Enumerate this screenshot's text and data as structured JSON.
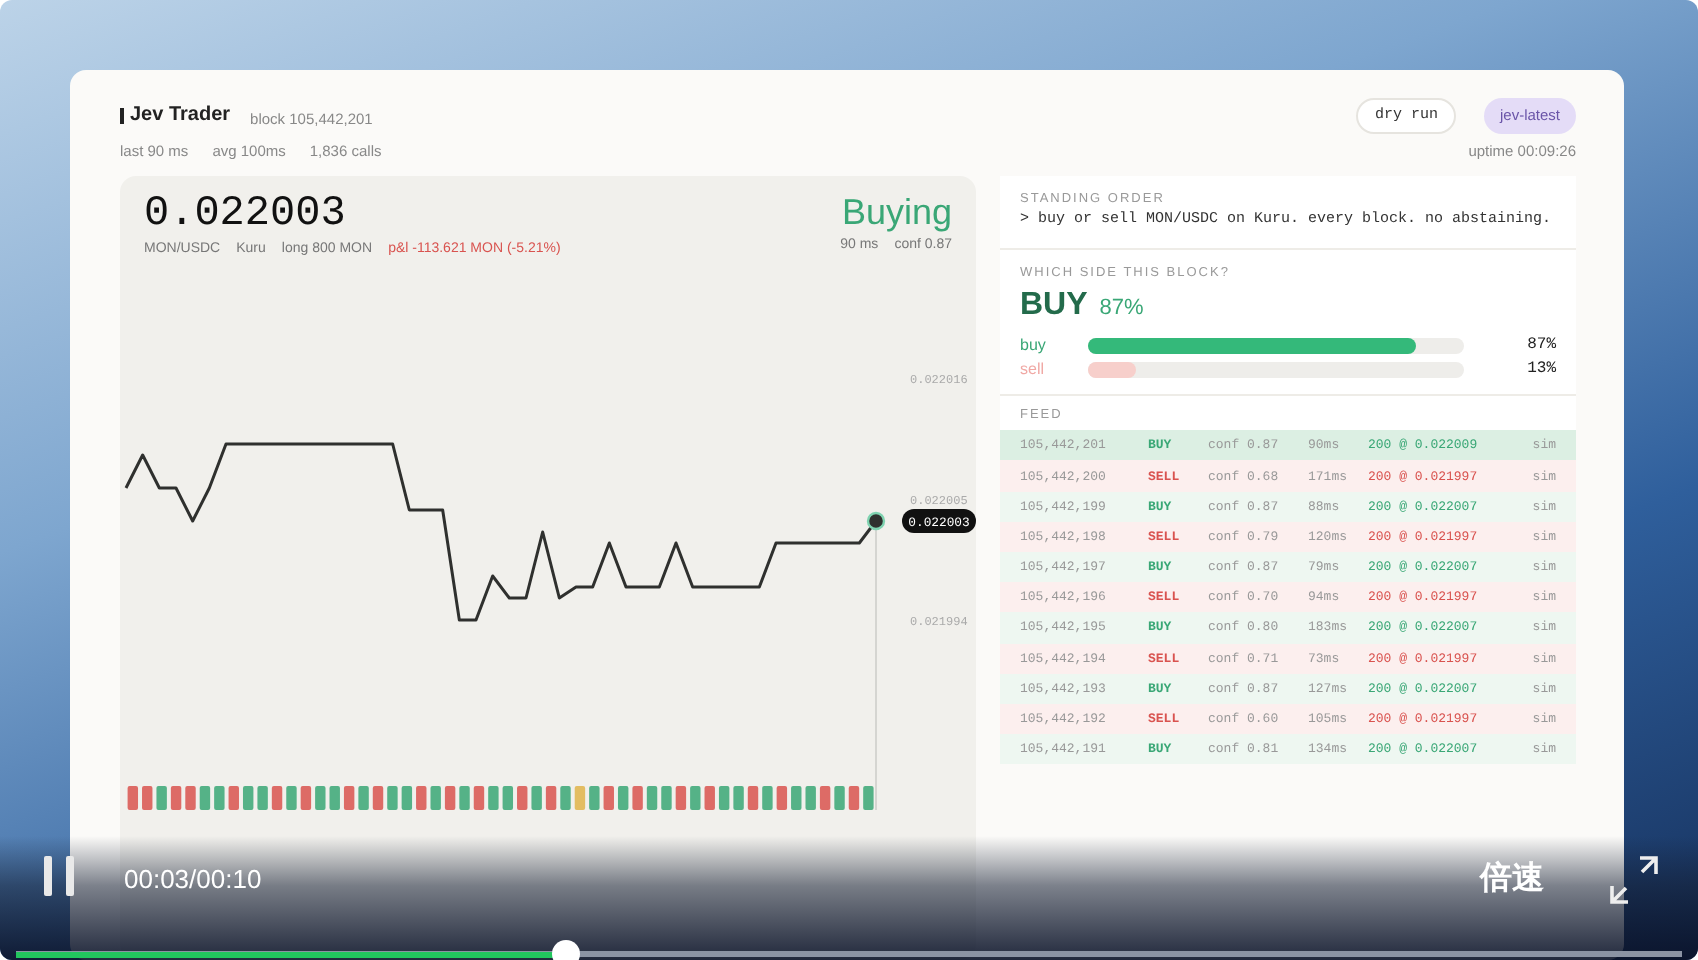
{
  "header": {
    "title": "Jev Trader",
    "block": "block 105,442,201",
    "stats": [
      "last 90 ms",
      "avg 100ms",
      "1,836 calls"
    ],
    "badges": [
      {
        "label": "dry run",
        "kind": "outline"
      },
      {
        "label": "jev-latest",
        "kind": "tag"
      }
    ],
    "uptime": "uptime 00:09:26"
  },
  "price_panel": {
    "price": "0.022003",
    "pair": "MON/USDC",
    "venue": "Kuru",
    "position": "long 800 MON",
    "pnl": "p&l -113.621 MON (-5.21%)",
    "action": "Buying",
    "latency": "90 ms",
    "confidence": "conf 0.87",
    "last_price_tag": "0.022003",
    "chart_data": {
      "type": "line",
      "ylim": [
        0.021994,
        0.022016
      ],
      "series": [
        {
          "color": "#2f302e",
          "values": [
            0.022006,
            0.022009,
            0.022006,
            0.022006,
            0.022003,
            0.022006,
            0.02201,
            0.02201,
            0.02201,
            0.02201,
            0.02201,
            0.02201,
            0.02201,
            0.02201,
            0.02201,
            0.02201,
            0.02201,
            0.022004,
            0.022004,
            0.022004,
            0.021994,
            0.021994,
            0.021998,
            0.021996,
            0.021996,
            0.022002,
            0.021996,
            0.021997,
            0.021997,
            0.022001,
            0.021997,
            0.021997,
            0.021997,
            0.022001,
            0.021997,
            0.021997,
            0.021997,
            0.021997,
            0.021997,
            0.022001,
            0.022001,
            0.022001,
            0.022001,
            0.022001,
            0.022001,
            0.022003
          ]
        }
      ],
      "yticks": [
        0.021994,
        0.022005,
        0.022016
      ]
    },
    "signal_strip": [
      {
        "kind": "sell"
      },
      {
        "kind": "sell"
      },
      {
        "kind": "buy"
      },
      {
        "kind": "sell"
      },
      {
        "kind": "sell"
      },
      {
        "kind": "buy"
      },
      {
        "kind": "buy"
      },
      {
        "kind": "sell"
      },
      {
        "kind": "buy"
      },
      {
        "kind": "buy"
      },
      {
        "kind": "sell"
      },
      {
        "kind": "buy"
      },
      {
        "kind": "sell"
      },
      {
        "kind": "buy"
      },
      {
        "kind": "buy"
      },
      {
        "kind": "sell"
      },
      {
        "kind": "buy"
      },
      {
        "kind": "sell"
      },
      {
        "kind": "buy"
      },
      {
        "kind": "buy"
      },
      {
        "kind": "sell"
      },
      {
        "kind": "buy"
      },
      {
        "kind": "sell"
      },
      {
        "kind": "buy"
      },
      {
        "kind": "sell"
      },
      {
        "kind": "buy"
      },
      {
        "kind": "buy"
      },
      {
        "kind": "sell"
      },
      {
        "kind": "buy"
      },
      {
        "kind": "sell"
      },
      {
        "kind": "buy"
      },
      {
        "kind": "hold"
      },
      {
        "kind": "buy"
      },
      {
        "kind": "sell"
      },
      {
        "kind": "buy"
      },
      {
        "kind": "sell"
      },
      {
        "kind": "buy"
      },
      {
        "kind": "buy"
      },
      {
        "kind": "sell"
      },
      {
        "kind": "buy"
      },
      {
        "kind": "sell"
      },
      {
        "kind": "buy"
      },
      {
        "kind": "buy"
      },
      {
        "kind": "sell"
      },
      {
        "kind": "buy"
      },
      {
        "kind": "sell"
      },
      {
        "kind": "buy"
      },
      {
        "kind": "buy"
      },
      {
        "kind": "sell"
      },
      {
        "kind": "buy"
      },
      {
        "kind": "sell"
      },
      {
        "kind": "buy"
      }
    ]
  },
  "standing_order": {
    "label": "STANDING ORDER",
    "text": "> buy or sell MON/USDC on Kuru. every block. no abstaining."
  },
  "decision": {
    "label": "WHICH SIDE THIS BLOCK?",
    "side": "BUY",
    "share": "87%",
    "bars": [
      {
        "label": "buy",
        "kind": "buy",
        "level": 0.87,
        "reading": "87%"
      },
      {
        "label": "sell",
        "kind": "sell",
        "level": 0.13,
        "reading": "13%"
      }
    ]
  },
  "feed": {
    "label": "FEED",
    "rows": [
      {
        "block": "105,442,201",
        "side": "BUY",
        "kind": "buy",
        "conf": "conf 0.87",
        "latency": "90ms",
        "fill": "200 @ 0.022009",
        "mode": "sim",
        "selected": true
      },
      {
        "block": "105,442,200",
        "side": "SELL",
        "kind": "sell",
        "conf": "conf 0.68",
        "latency": "171ms",
        "fill": "200 @ 0.021997",
        "mode": "sim",
        "selected": false
      },
      {
        "block": "105,442,199",
        "side": "BUY",
        "kind": "buy",
        "conf": "conf 0.87",
        "latency": "88ms",
        "fill": "200 @ 0.022007",
        "mode": "sim",
        "selected": false
      },
      {
        "block": "105,442,198",
        "side": "SELL",
        "kind": "sell",
        "conf": "conf 0.79",
        "latency": "120ms",
        "fill": "200 @ 0.021997",
        "mode": "sim",
        "selected": false
      },
      {
        "block": "105,442,197",
        "side": "BUY",
        "kind": "buy",
        "conf": "conf 0.87",
        "latency": "79ms",
        "fill": "200 @ 0.022007",
        "mode": "sim",
        "selected": false
      },
      {
        "block": "105,442,196",
        "side": "SELL",
        "kind": "sell",
        "conf": "conf 0.70",
        "latency": "94ms",
        "fill": "200 @ 0.021997",
        "mode": "sim",
        "selected": false
      },
      {
        "block": "105,442,195",
        "side": "BUY",
        "kind": "buy",
        "conf": "conf 0.80",
        "latency": "183ms",
        "fill": "200 @ 0.022007",
        "mode": "sim",
        "selected": false
      },
      {
        "block": "105,442,194",
        "side": "SELL",
        "kind": "sell",
        "conf": "conf 0.71",
        "latency": "73ms",
        "fill": "200 @ 0.021997",
        "mode": "sim",
        "selected": false
      },
      {
        "block": "105,442,193",
        "side": "BUY",
        "kind": "buy",
        "conf": "conf 0.87",
        "latency": "127ms",
        "fill": "200 @ 0.022007",
        "mode": "sim",
        "selected": false
      },
      {
        "block": "105,442,192",
        "side": "SELL",
        "kind": "sell",
        "conf": "conf 0.60",
        "latency": "105ms",
        "fill": "200 @ 0.021997",
        "mode": "sim",
        "selected": false
      },
      {
        "block": "105,442,191",
        "side": "BUY",
        "kind": "buy",
        "conf": "conf 0.81",
        "latency": "134ms",
        "fill": "200 @ 0.022007",
        "mode": "sim",
        "selected": false
      }
    ]
  },
  "player": {
    "playing": true,
    "time": "00:03/00:10",
    "speed": "倍速",
    "level": 0.33
  }
}
